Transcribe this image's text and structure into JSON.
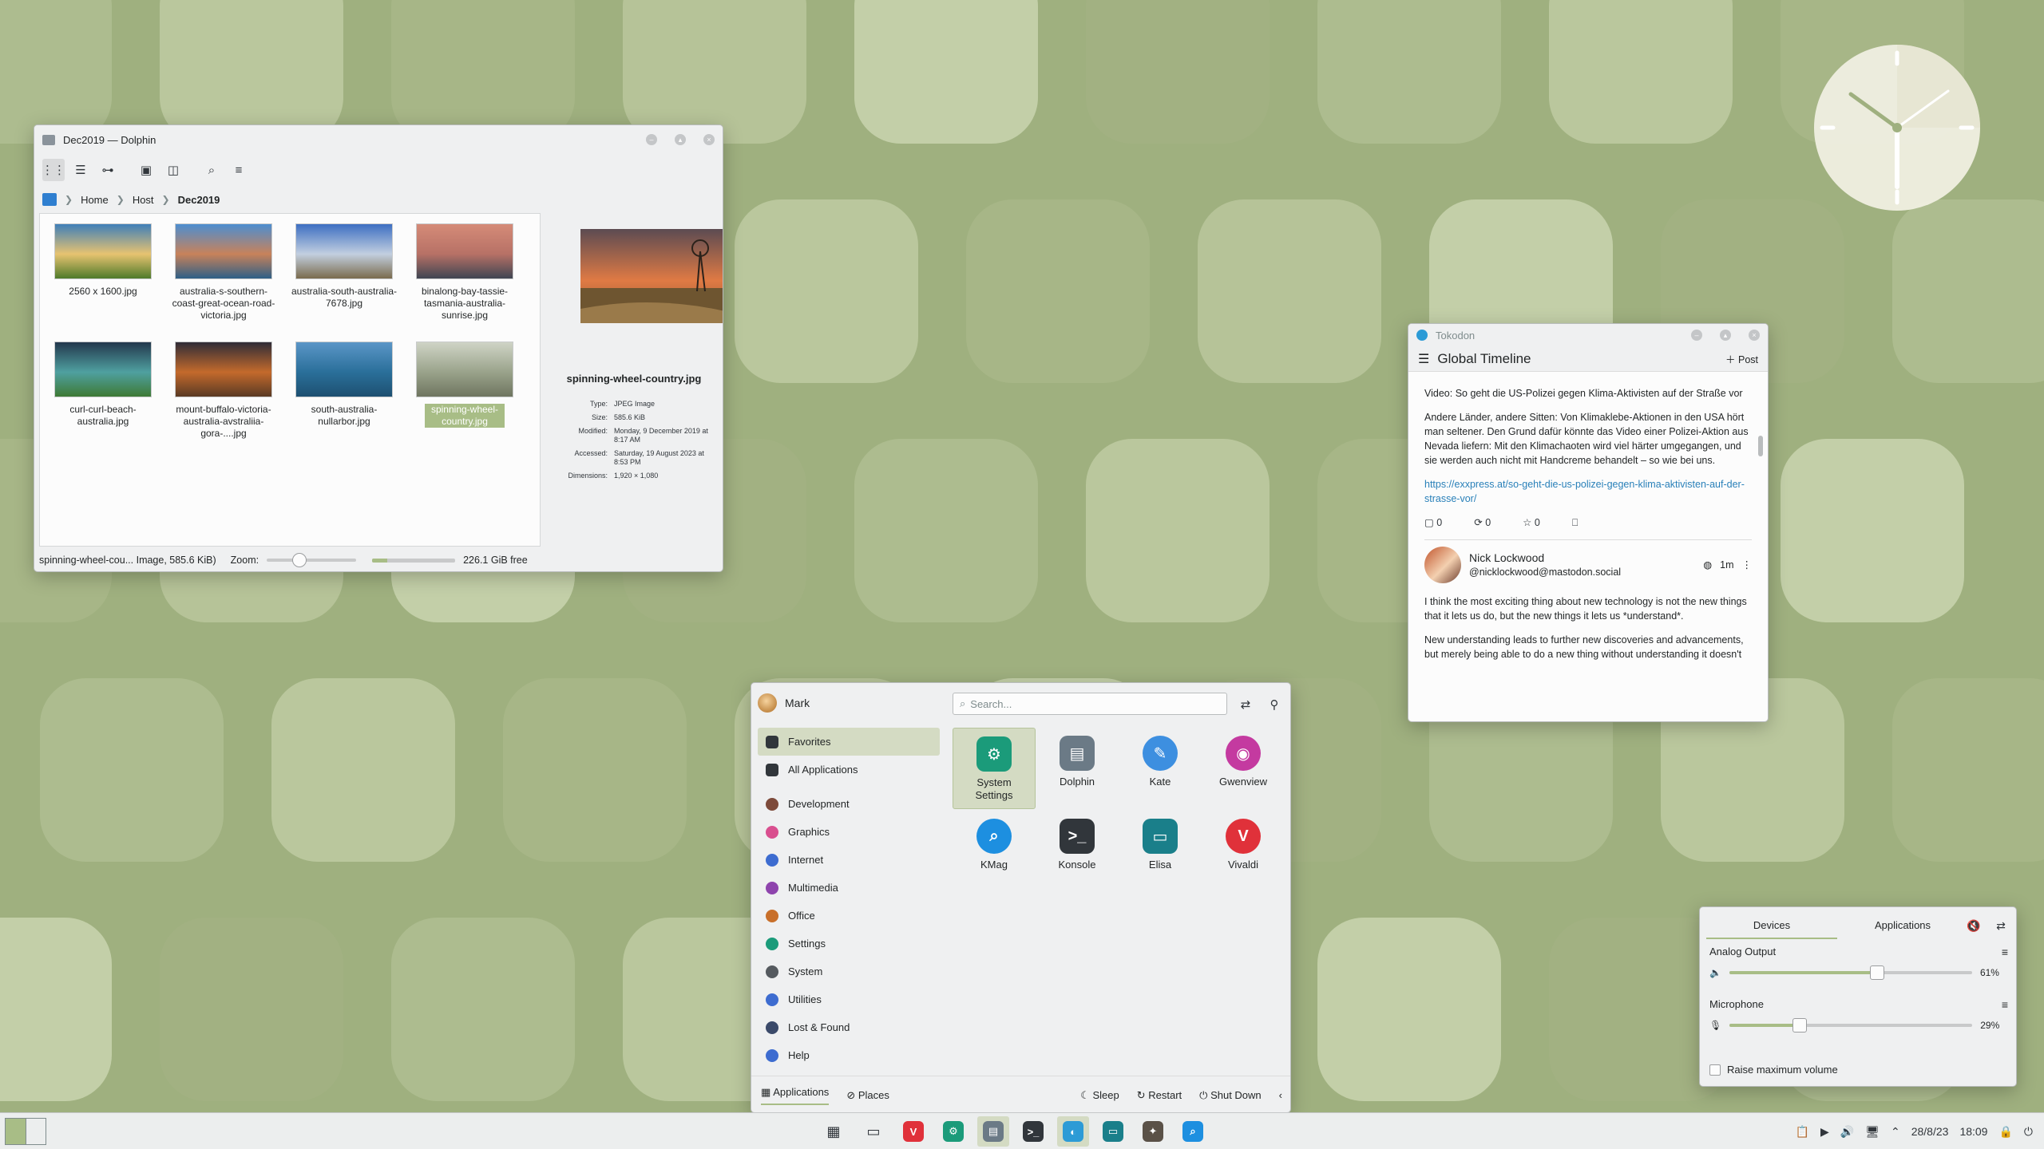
{
  "colors": {
    "accent": "#a8bd86",
    "link": "#2980b9",
    "window_bg": "#eff0f1",
    "wallpaper": "#9fb07f"
  },
  "dolphin": {
    "title": "Dec2019 — Dolphin",
    "breadcrumb": [
      "Home",
      "Host",
      "Dec2019"
    ],
    "files": [
      {
        "name": "2560 x 1600.jpg",
        "colors": [
          "#3f7fb9",
          "#e7c370",
          "#4f7a2a"
        ]
      },
      {
        "name": "australia-s-southern-coast-great-ocean-road-victoria.jpg",
        "colors": [
          "#4d8ed0",
          "#c8825a",
          "#2e5f86"
        ]
      },
      {
        "name": "australia-south-australia-7678.jpg",
        "colors": [
          "#3d6fc2",
          "#c2cfe0",
          "#7a6b4d"
        ]
      },
      {
        "name": "binalong-bay-tassie-tasmania-australia-sunrise.jpg",
        "colors": [
          "#d58b78",
          "#b77166",
          "#3f4552"
        ]
      },
      {
        "name": "curl-curl-beach-australia.jpg",
        "colors": [
          "#23384d",
          "#4fa0a0",
          "#3e7a35"
        ]
      },
      {
        "name": "mount-buffalo-victoria-australia-avstraliia-gora-....jpg",
        "colors": [
          "#2f2c37",
          "#c46a2c",
          "#5a3a24"
        ]
      },
      {
        "name": "south-australia-nullarbor.jpg",
        "colors": [
          "#5b96c7",
          "#2a6f9a",
          "#1e5071"
        ]
      },
      {
        "name": "spinning-wheel-country.jpg",
        "colors": [
          "#cfd4c6",
          "#9aa38b",
          "#6f7560"
        ]
      }
    ],
    "info": {
      "name": "spinning-wheel-country.jpg",
      "type_label": "Type:",
      "type": "JPEG Image",
      "size_label": "Size:",
      "size": "585.6 KiB",
      "modified_label": "Modified:",
      "modified": "Monday, 9 December 2019 at 8:17 AM",
      "accessed_label": "Accessed:",
      "accessed": "Saturday, 19 August 2023 at 8:53 PM",
      "dimensions_label": "Dimensions:",
      "dimensions": "1,920 × 1,080"
    },
    "status": {
      "selection": "spinning-wheel-cou... Image, 585.6 KiB)",
      "zoom_label": "Zoom:",
      "zoom_level": 0.22,
      "free_space": "226.1 GiB free",
      "used_fraction": 0.18
    }
  },
  "tokodon": {
    "title": "Tokodon",
    "timeline_title": "Global Timeline",
    "post_label": "Post",
    "post1": {
      "headline": "Video: So geht die US-Polizei gegen Klima-Aktivisten auf der Straße vor",
      "body": "Andere Länder, andere Sitten: Von Klimaklebe-Aktionen in den USA hört man seltener. Den Grund dafür könnte das Video einer Polizei-Aktion aus Nevada liefern: Mit den Klimachaoten wird viel härter umgegangen, und sie werden auch nicht mit Handcreme behandelt – so wie bei uns.",
      "link": "https://exxpress.at/so-geht-die-us-polizei-gegen-klima-aktivisten-auf-der-strasse-vor/",
      "replies": "0",
      "boosts": "0",
      "favourites": "0"
    },
    "post2": {
      "author": "Nick Lockwood",
      "handle": "@nicklockwood@mastodon.social",
      "age": "1m",
      "p1": "I think the most exciting thing about new technology is not the new things that it lets us do, but the new things it lets us *understand*.",
      "p2": "New understanding leads to further new discoveries and advancements, but merely being able to do a new thing without understanding it doesn't"
    }
  },
  "kickoff": {
    "user": "Mark",
    "search_placeholder": "Search...",
    "categories": [
      {
        "label": "Favorites",
        "color": "#31363b"
      },
      {
        "label": "All Applications",
        "color": "#31363b"
      },
      {
        "label": "Development",
        "color": "#7d4a3a"
      },
      {
        "label": "Graphics",
        "color": "#d94f8f"
      },
      {
        "label": "Internet",
        "color": "#3d6cd0"
      },
      {
        "label": "Multimedia",
        "color": "#8e44ad"
      },
      {
        "label": "Office",
        "color": "#c86f2a"
      },
      {
        "label": "Settings",
        "color": "#1b9b7a"
      },
      {
        "label": "System",
        "color": "#555a5f"
      },
      {
        "label": "Utilities",
        "color": "#3d6cd0"
      },
      {
        "label": "Lost & Found",
        "color": "#3b4a6a"
      },
      {
        "label": "Help",
        "color": "#3d6cd0"
      }
    ],
    "apps": [
      {
        "name": "System Settings",
        "color": "#1b9b7a",
        "glyph": "⚙"
      },
      {
        "name": "Dolphin",
        "color": "#6b7a86",
        "glyph": "▤"
      },
      {
        "name": "Kate",
        "color": "#3d8fe0",
        "glyph": "✎"
      },
      {
        "name": "Gwenview",
        "color": "#c43aa0",
        "glyph": "◉"
      },
      {
        "name": "KMag",
        "color": "#1d8fe0",
        "glyph": "⌕"
      },
      {
        "name": "Konsole",
        "color": "#31363b",
        "glyph": ">_"
      },
      {
        "name": "Elisa",
        "color": "#1a7f8a",
        "glyph": "▭"
      },
      {
        "name": "Vivaldi",
        "color": "#e0313a",
        "glyph": "V"
      }
    ],
    "footer": {
      "applications": "Applications",
      "places": "Places",
      "sleep": "Sleep",
      "restart": "Restart",
      "shutdown": "Shut Down"
    }
  },
  "volume": {
    "tab_devices": "Devices",
    "tab_applications": "Applications",
    "output_label": "Analog Output",
    "output_value": 61,
    "output_text": "61%",
    "mic_label": "Microphone",
    "mic_value": 29,
    "mic_text": "29%",
    "raise_label": "Raise maximum volume"
  },
  "panel": {
    "date": "28/8/23",
    "time": "18:09",
    "tasks": [
      {
        "id": "overview",
        "color": "#eceeee",
        "glyph": "▦",
        "dark": true
      },
      {
        "id": "desktop",
        "color": "#eceeee",
        "glyph": "▭",
        "dark": true
      },
      {
        "id": "vivaldi",
        "color": "#e0313a",
        "glyph": "V"
      },
      {
        "id": "system-settings",
        "color": "#1b9b7a",
        "glyph": "⚙"
      },
      {
        "id": "dolphin",
        "color": "#6b7a86",
        "glyph": "▤",
        "active": true
      },
      {
        "id": "konsole",
        "color": "#31363b",
        "glyph": ">_"
      },
      {
        "id": "tokodon",
        "color": "#2c9bd6",
        "glyph": "◐",
        "active": true
      },
      {
        "id": "elisa",
        "color": "#1a7f8a",
        "glyph": "▭"
      },
      {
        "id": "gimp",
        "color": "#5a5147",
        "glyph": "✦"
      },
      {
        "id": "kmag",
        "color": "#1d8fe0",
        "glyph": "⌕"
      }
    ]
  }
}
